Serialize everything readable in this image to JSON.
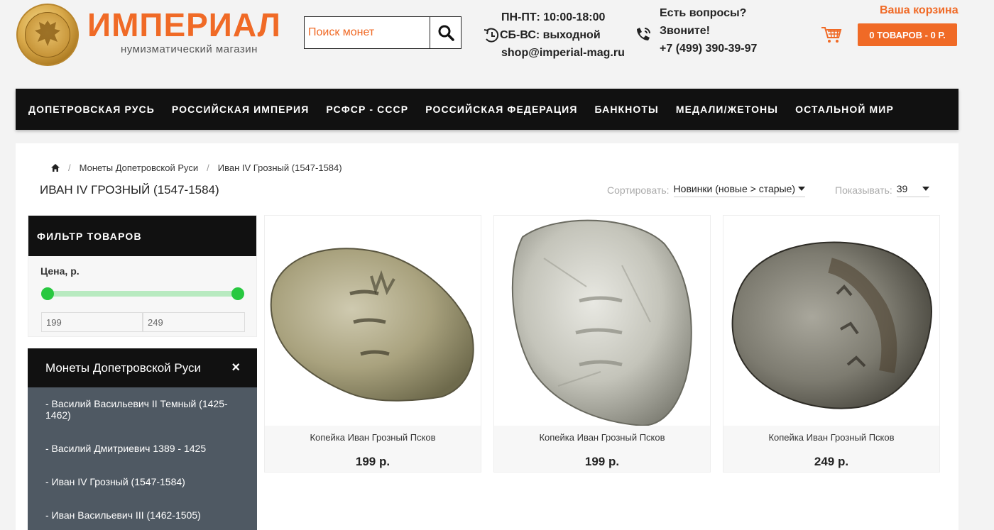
{
  "header": {
    "logo_title": "ИМПЕРИАЛ",
    "logo_subtitle": "нумизматический магазин",
    "search_placeholder": "Поиск монет",
    "hours_weekdays": "ПН-ПТ: 10:00-18:00",
    "hours_weekend": "СБ-ВС: выходной",
    "email": "shop@imperial-mag.ru",
    "questions": "Есть вопросы?",
    "call": "Звоните!",
    "phone": "+7 (499) 390-39-97",
    "cart_label": "Ваша корзина",
    "cart_button": "0 ТОВАРОВ - 0 Р."
  },
  "nav": [
    "ДОПЕТРОВСКАЯ РУСЬ",
    "РОССИЙСКАЯ ИМПЕРИЯ",
    "РСФСР - СССР",
    "РОССИЙСКАЯ ФЕДЕРАЦИЯ",
    "БАНКНОТЫ",
    "МЕДАЛИ/ЖЕТОНЫ",
    "ОСТАЛЬНОЙ МИР"
  ],
  "breadcrumb": {
    "level1": "Монеты Допетровской Руси",
    "level2": "Иван IV Грозный (1547-1584)"
  },
  "page_title": "ИВАН IV ГРОЗНЫЙ (1547-1584)",
  "sort": {
    "label": "Сортировать:",
    "value": "Новинки (новые > старые)"
  },
  "show": {
    "label": "Показывать:",
    "value": "39"
  },
  "filter": {
    "title": "ФИЛЬТР ТОВАРОВ",
    "price_label": "Цена, р.",
    "min": "199",
    "max": "249",
    "range_min_fraction": 0,
    "range_max_fraction": 1
  },
  "category": {
    "title": "Монеты Допетровской Руси",
    "close": "×",
    "items": [
      "- Василий Васильевич II Темный (1425-1462)",
      "- Василий Дмитриевич 1389 - 1425",
      "- Иван IV Грозный (1547-1584)",
      "- Иван Васильевич III (1462-1505)"
    ]
  },
  "products": [
    {
      "name": "Копейка Иван Грозный Псков",
      "price": "199 р."
    },
    {
      "name": "Копейка Иван Грозный Псков",
      "price": "199 р."
    },
    {
      "name": "Копейка Иван Грозный Псков",
      "price": "249 р."
    }
  ],
  "colors": {
    "accent": "#f06a26",
    "nav_bg": "#111111",
    "slider": "#28c840",
    "category_bg": "#4f5963"
  }
}
